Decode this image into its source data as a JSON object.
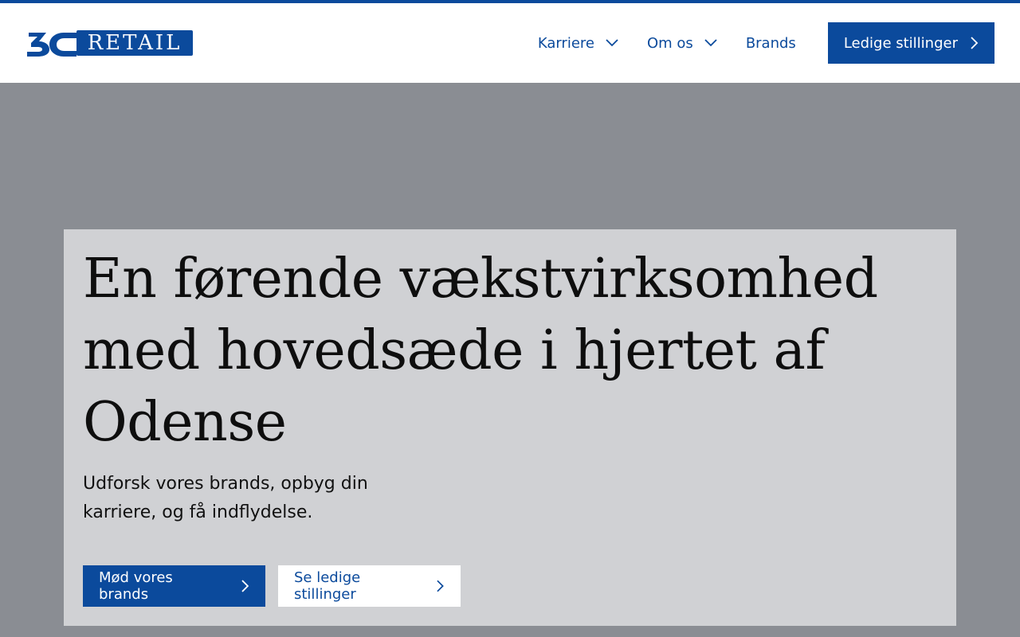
{
  "brand": {
    "logo_text": "RETAIL",
    "logo_mark": "3C",
    "color": "#0b4a9c"
  },
  "nav": {
    "items": [
      {
        "label": "Karriere",
        "icon": "chevron-down-icon"
      },
      {
        "label": "Om os",
        "icon": "chevron-down-icon"
      },
      {
        "label": "Brands"
      }
    ],
    "cta_label": "Ledige stillinger",
    "cta_icon": "chevron-right-icon"
  },
  "hero": {
    "title": "En førende vækstvirksomhed med hovedsæde i hjertet af Odense",
    "subtitle": "Udforsk vores brands, opbyg din karriere, og få indflydelse.",
    "primary_button": "Mød vores brands",
    "secondary_button": "Se ledige stillinger",
    "background_color": "#8a8d93",
    "panel_color": "#d0d1d4"
  }
}
